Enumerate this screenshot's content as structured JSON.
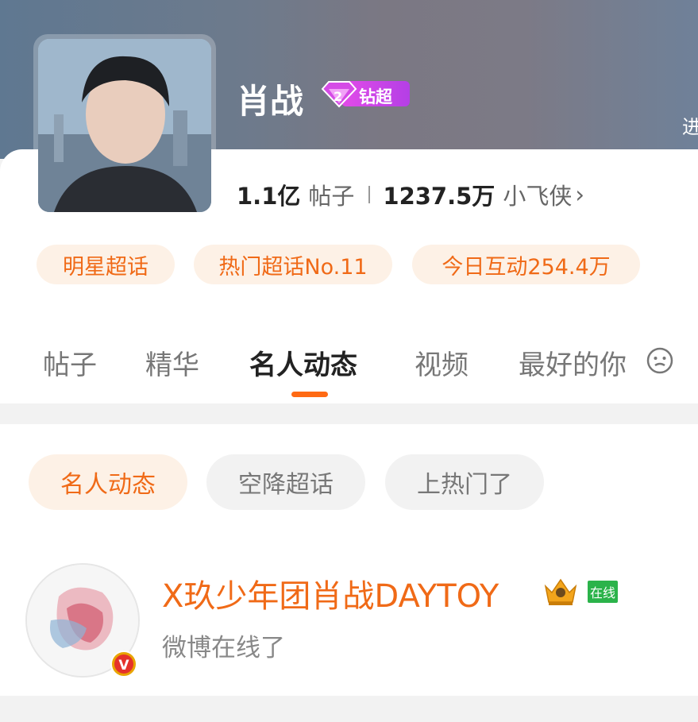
{
  "profile": {
    "name": "肖战",
    "badge_level": "2",
    "badge_label": "钻超",
    "edge_text": "进",
    "posts_count": "1.1亿",
    "posts_label": "帖子",
    "fans_count": "1237.5万",
    "fans_label": "小飞侠",
    "fans_chevron": "›"
  },
  "tags": [
    "明星超话",
    "热门超话No.11",
    "今日互动254.4万"
  ],
  "tabs": [
    {
      "label": "帖子",
      "active": false
    },
    {
      "label": "精华",
      "active": false
    },
    {
      "label": "名人动态",
      "active": true
    },
    {
      "label": "视频",
      "active": false
    },
    {
      "label": "最好的你",
      "active": false
    }
  ],
  "filters": [
    {
      "label": "名人动态",
      "active": true
    },
    {
      "label": "空降超话",
      "active": false
    },
    {
      "label": "上热门了",
      "active": false
    }
  ],
  "feed": {
    "username": "X玖少年团肖战DAYTOY",
    "online_label": "在线",
    "status_text": "微博在线了",
    "verified_mark": "V"
  },
  "colors": {
    "accent": "#f06a17",
    "indicator": "#ff6a13",
    "tag_bg": "#fdf1e6",
    "online_green": "#2bb34a"
  }
}
